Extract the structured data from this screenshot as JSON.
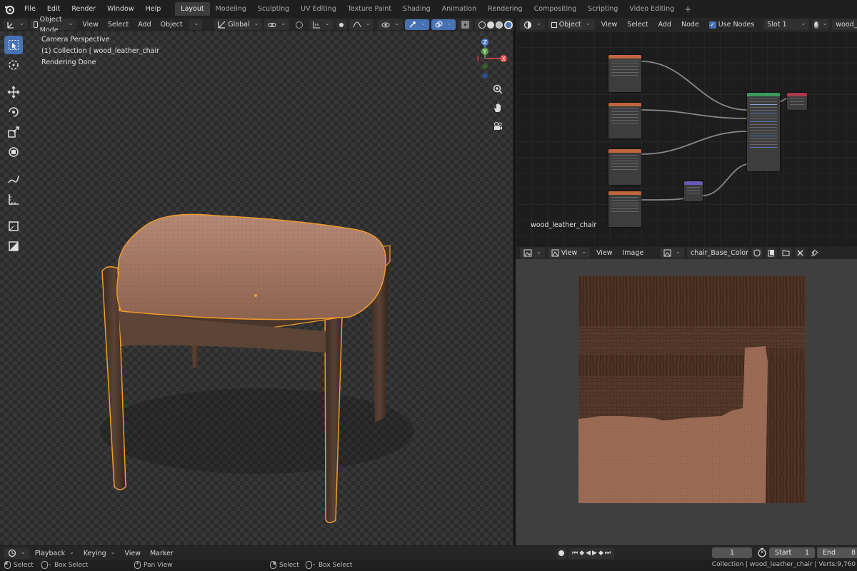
{
  "topbar": {
    "menus": [
      "File",
      "Edit",
      "Render",
      "Window",
      "Help"
    ],
    "workspaces": [
      "Layout",
      "Modeling",
      "Sculpting",
      "UV Editing",
      "Texture Paint",
      "Shading",
      "Animation",
      "Rendering",
      "Compositing",
      "Scripting",
      "Video Editing"
    ],
    "active_workspace": "Layout"
  },
  "viewport": {
    "mode": "Object Mode",
    "menus": [
      "View",
      "Select",
      "Add",
      "Object"
    ],
    "transform_orientation": "Global",
    "overlay_lines": [
      "Camera Perspective",
      "(1) Collection | wood_leather_chair",
      "Rendering Done"
    ],
    "gizmo_labels": {
      "x": "X",
      "y": "Y",
      "z": "Z"
    }
  },
  "node_editor": {
    "type": "Object",
    "menus": [
      "View",
      "Select",
      "Add",
      "Node"
    ],
    "use_nodes_label": "Use Nodes",
    "use_nodes_checked": true,
    "slot": "Slot 1",
    "material": "wood_leather_ch",
    "material_label": "wood_leather_chair"
  },
  "image_editor": {
    "view_mode": "View",
    "menus": [
      "View",
      "Image"
    ],
    "image_name": "chair_Base_Color.png"
  },
  "timeline": {
    "menus": [
      "Playback",
      "Keying",
      "View",
      "Marker"
    ],
    "current_frame": "1",
    "start_label": "Start",
    "start_value": "1",
    "end_label": "End",
    "end_value": "8"
  },
  "statusbar": {
    "left_select": "Select",
    "box_select": "Box Select",
    "pan_view": "Pan View",
    "mid_select": "Select",
    "mid_box_select": "Box Select",
    "info": "Collection | wood_leather_chair | Verts:9,760"
  },
  "colors": {
    "accent": "#4772b3",
    "selection_outline": "#f29d2b",
    "active_tab": "#3d3d3d"
  }
}
